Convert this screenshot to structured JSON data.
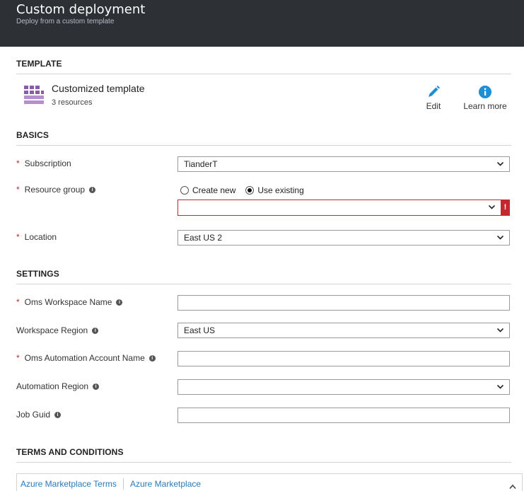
{
  "header": {
    "title": "Custom deployment",
    "subtitle": "Deploy from a custom template"
  },
  "template": {
    "section_title": "TEMPLATE",
    "name": "Customized template",
    "resources": "3 resources",
    "edit_label": "Edit",
    "learn_more_label": "Learn more"
  },
  "basics": {
    "section_title": "BASICS",
    "subscription": {
      "label": "Subscription",
      "value": "TianderT"
    },
    "resource_group": {
      "label": "Resource group",
      "create_new_label": "Create new",
      "use_existing_label": "Use existing",
      "selected": "Use existing",
      "value": "",
      "error_mark": "!"
    },
    "location": {
      "label": "Location",
      "value": "East US 2"
    }
  },
  "settings": {
    "section_title": "SETTINGS",
    "oms_workspace_name": {
      "label": "Oms Workspace Name",
      "value": ""
    },
    "workspace_region": {
      "label": "Workspace Region",
      "value": "East US"
    },
    "oms_automation_account_name": {
      "label": "Oms Automation Account Name",
      "value": ""
    },
    "automation_region": {
      "label": "Automation Region",
      "value": ""
    },
    "job_guid": {
      "label": "Job Guid",
      "value": ""
    }
  },
  "terms": {
    "section_title": "TERMS AND CONDITIONS",
    "link1": "Azure Marketplace Terms",
    "link2": "Azure Marketplace"
  },
  "colors": {
    "header_bg": "#2d3035",
    "required": "#c2282d",
    "link": "#2a7ab8",
    "accent": "#1e8fd5",
    "template_icon": "#8a5ca8"
  }
}
